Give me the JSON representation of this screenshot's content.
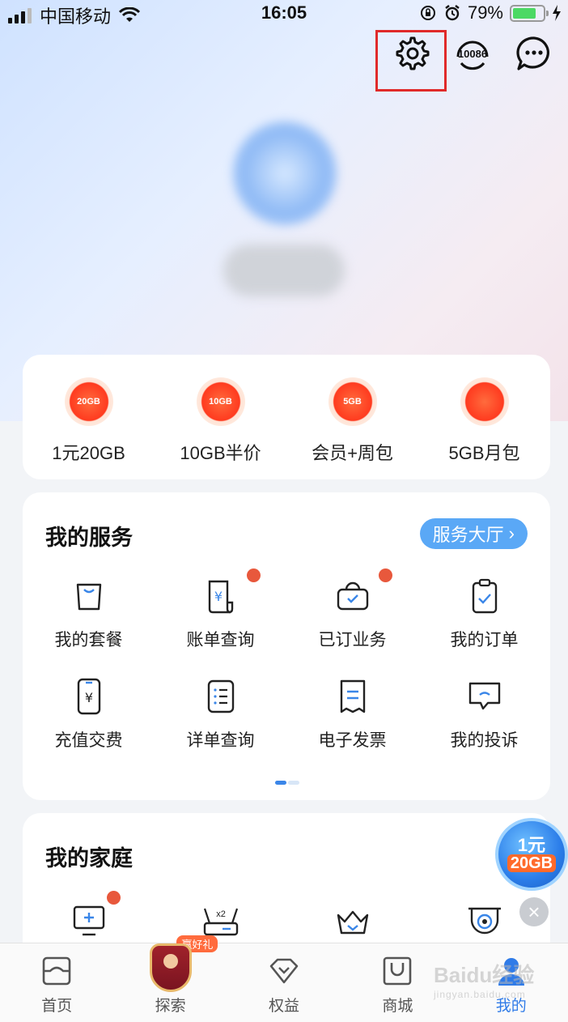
{
  "status_bar": {
    "carrier": "中国移动",
    "time": "16:05",
    "battery": "79%"
  },
  "top_actions": {
    "hotline_label": "10086"
  },
  "promos": [
    {
      "label": "1元20GB",
      "icon_text": "20GB"
    },
    {
      "label": "10GB半价",
      "icon_text": "10GB"
    },
    {
      "label": "会员+周包",
      "icon_text": "5GB"
    },
    {
      "label": "5GB月包",
      "icon_text": ""
    }
  ],
  "services": {
    "title": "我的服务",
    "hall_label": "服务大厅",
    "items": [
      {
        "label": "我的套餐"
      },
      {
        "label": "账单查询"
      },
      {
        "label": "已订业务"
      },
      {
        "label": "我的订单"
      },
      {
        "label": "充值交费"
      },
      {
        "label": "详单查询"
      },
      {
        "label": "电子发票"
      },
      {
        "label": "我的投诉"
      }
    ]
  },
  "family": {
    "title": "我的家庭",
    "router_tag": "x2"
  },
  "float_promo": {
    "line1": "1元",
    "line2": "20GB"
  },
  "tabs": [
    {
      "label": "首页"
    },
    {
      "label": "探索",
      "badge": "赢好礼"
    },
    {
      "label": "权益"
    },
    {
      "label": "商城"
    },
    {
      "label": "我的"
    }
  ],
  "watermark": {
    "text": "Baidu经验",
    "sub": "jingyan.baidu.com"
  },
  "colors": {
    "accent_blue": "#2f7be8",
    "badge_red": "#e8583c",
    "highlight_box": "#e02a2a"
  }
}
